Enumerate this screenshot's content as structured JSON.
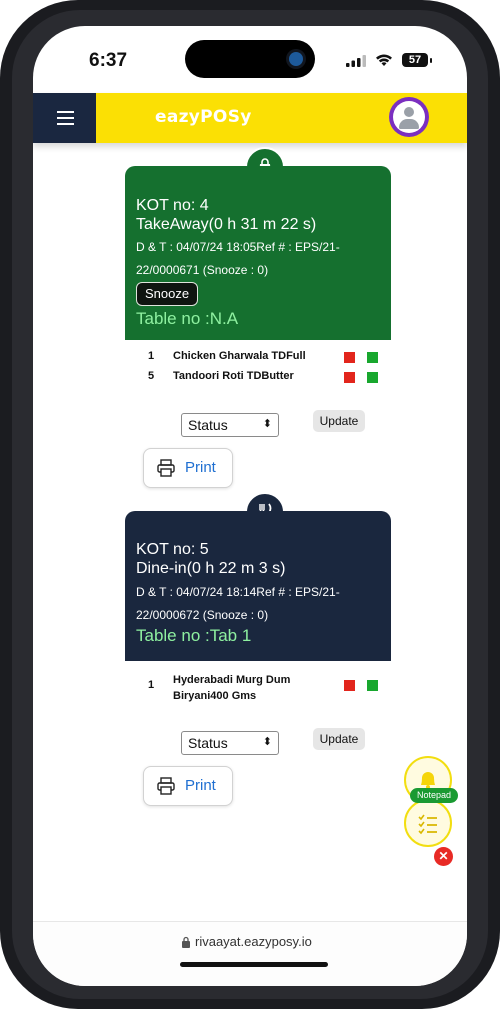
{
  "status_bar": {
    "time": "6:37",
    "battery": "57"
  },
  "header": {
    "logo": "eazyPOSy",
    "menu_icon": "hamburger-icon",
    "avatar_icon": "user-avatar-icon"
  },
  "kots": [
    {
      "kot_no": "KOT no: 4",
      "type_time": "TakeAway(0 h 31 m 22 s)",
      "dt_line1": "D & T : 04/07/24 18:05Ref # : EPS/21-",
      "dt_line2": "22/0000671  (Snooze : 0)",
      "snooze_label": "Snooze",
      "table_no": "Table no :N.A",
      "icon": "shopping-bag-icon",
      "accent": "#15702f",
      "items": [
        {
          "qty": "1",
          "name": "Chicken Gharwala TDFull"
        },
        {
          "qty": "5",
          "name": "Tandoori Roti TDButter"
        }
      ],
      "status_value": "Status",
      "update_label": "Update",
      "print_label": "Print"
    },
    {
      "kot_no": "KOT no: 5",
      "type_time": "Dine-in(0 h 22 m 3 s)",
      "dt_line1": "D & T : 04/07/24 18:14Ref # : EPS/21-",
      "dt_line2": "22/0000672  (Snooze : 0)",
      "table_no": "Table no :Tab 1",
      "icon": "fork-knife-icon",
      "accent": "#1a273e",
      "items": [
        {
          "qty": "1",
          "name": "Hyderabadi Murg Dum Biryani400 Gms"
        }
      ],
      "status_value": "Status",
      "update_label": "Update",
      "print_label": "Print"
    }
  ],
  "floating": {
    "notepad_label": "Notepad",
    "close_label": "✕"
  },
  "browser": {
    "url": "rivaayat.eazyposy.io"
  }
}
